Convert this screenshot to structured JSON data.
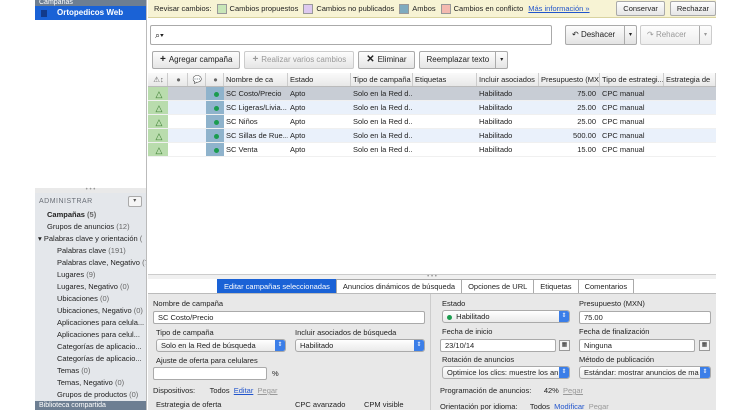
{
  "sidebar": {
    "header": "Campañas",
    "account": "Ortopedicos Web",
    "admin_title": "ADMINISTRAR",
    "admin_button": "▾",
    "items": [
      {
        "label": "Campañas",
        "count": "(5)"
      },
      {
        "label": "Grupos de anuncios",
        "count": "(12)"
      },
      {
        "label": "Palabras clave y orientación",
        "count": "("
      },
      {
        "label": "Palabras clave",
        "count": "(191)"
      },
      {
        "label": "Palabras clave, Negativo",
        "count": "(7"
      },
      {
        "label": "Lugares",
        "count": "(9)"
      },
      {
        "label": "Lugares, Negativo",
        "count": "(0)"
      },
      {
        "label": "Ubicaciones",
        "count": "(0)"
      },
      {
        "label": "Ubicaciones, Negativo",
        "count": "(0)"
      },
      {
        "label": "Aplicaciones para celula...",
        "count": ""
      },
      {
        "label": "Aplicaciones para celul...",
        "count": ""
      },
      {
        "label": "Categorías de aplicacio...",
        "count": ""
      },
      {
        "label": "Categorías de aplicacio...",
        "count": ""
      },
      {
        "label": "Temas",
        "count": "(0)"
      },
      {
        "label": "Temas, Negativo",
        "count": "(0)"
      },
      {
        "label": "Grupos de productos",
        "count": "(0)"
      }
    ],
    "library": "Biblioteca compartida"
  },
  "review": {
    "label": "Revisar cambios:",
    "chips": [
      {
        "label": "Cambios propuestos",
        "color": "#c8e6b8"
      },
      {
        "label": "Cambios no publicados",
        "color": "#ddc9ef"
      },
      {
        "label": "Ambos",
        "color": "#7eaabf"
      },
      {
        "label": "Cambios en conflicto",
        "color": "#f4b9b0"
      }
    ],
    "more_info": "Más información »",
    "keep": "Conservar",
    "reject": "Rechazar"
  },
  "search": {
    "icon_label": "⌕▾",
    "placeholder": ""
  },
  "undo": "Deshacer",
  "redo": "Rehacer",
  "toolbar": {
    "add": "Agregar campaña",
    "multi": "Realizar varios cambios",
    "delete": "Eliminar",
    "replace": "Reemplazar texto"
  },
  "grid": {
    "columns": [
      "",
      "",
      "",
      "",
      "Nombre de ca",
      "Estado",
      "Tipo de campaña",
      "Etiquetas",
      "Incluir asociados",
      "Presupuesto (MXN)",
      "Tipo de estrategi...",
      "Estrategia de"
    ],
    "rows": [
      {
        "name": "SC Costo/Precio",
        "status": "Apto",
        "type": "Solo en la Red d...",
        "labels": "",
        "partners": "Habilitado",
        "budget": "75.00",
        "strategy": "CPC manual"
      },
      {
        "name": "SC Ligeras/Livia...",
        "status": "Apto",
        "type": "Solo en la Red d...",
        "labels": "",
        "partners": "Habilitado",
        "budget": "25.00",
        "strategy": "CPC manual"
      },
      {
        "name": "SC Niños",
        "status": "Apto",
        "type": "Solo en la Red d...",
        "labels": "",
        "partners": "Habilitado",
        "budget": "25.00",
        "strategy": "CPC manual"
      },
      {
        "name": "SC Sillas de Rue...",
        "status": "Apto",
        "type": "Solo en la Red d...",
        "labels": "",
        "partners": "Habilitado",
        "budget": "500.00",
        "strategy": "CPC manual"
      },
      {
        "name": "SC Venta",
        "status": "Apto",
        "type": "Solo en la Red d...",
        "labels": "",
        "partners": "Habilitado",
        "budget": "15.00",
        "strategy": "CPC manual"
      }
    ]
  },
  "tabs": [
    "Editar campañas seleccionadas",
    "Anuncios dinámicos de búsqueda",
    "Opciones de URL",
    "Etiquetas",
    "Comentarios"
  ],
  "edit": {
    "name_label": "Nombre de campaña",
    "name_value": "SC Costo/Precio",
    "type_label": "Tipo de campaña",
    "type_value": "Solo en la Red de búsqueda",
    "partners_label": "Incluir asociados de búsqueda",
    "partners_value": "Habilitado",
    "mobile_label": "Ajuste de oferta para celulares",
    "mobile_value": "",
    "percent": "%",
    "devices_label": "Dispositivos:",
    "devices_value": "Todos",
    "devices_edit": "Editar",
    "devices_paste": "Pegar",
    "strategy_label": "Estrategia de oferta",
    "cpc_label": "CPC avanzado",
    "cpm_label": "CPM visible",
    "status_label": "Estado",
    "status_value": "Habilitado",
    "budget_label": "Presupuesto (MXN)",
    "budget_value": "75.00",
    "start_label": "Fecha de inicio",
    "start_value": "23/10/14",
    "end_label": "Fecha de finalización",
    "end_value": "Ninguna",
    "rotation_label": "Rotación de anuncios",
    "rotation_value": "Optimice los clics: muestre los an",
    "method_label": "Método de publicación",
    "method_value": "Estándar: mostrar anuncios de ma",
    "schedule_label": "Programación de anuncios:",
    "schedule_value": "42%",
    "schedule_paste": "Pegar",
    "lang_label": "Orientación por idioma:",
    "lang_value": "Todos",
    "lang_edit": "Modificar",
    "lang_paste": "Pegar"
  }
}
